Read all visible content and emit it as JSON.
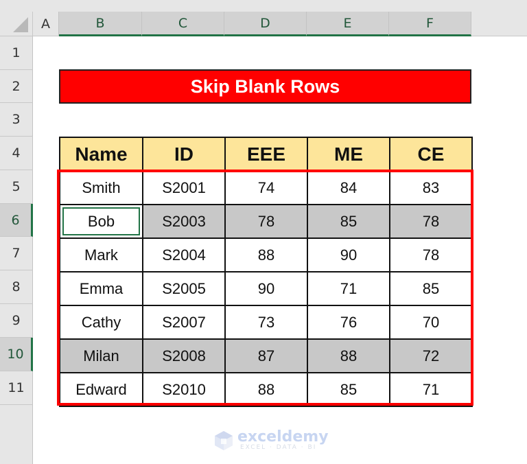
{
  "spreadsheet": {
    "columns": [
      "A",
      "B",
      "C",
      "D",
      "E",
      "F"
    ],
    "rows": [
      "1",
      "2",
      "3",
      "4",
      "5",
      "6",
      "7",
      "8",
      "9",
      "10",
      "11"
    ],
    "selected_columns": [
      "B",
      "C",
      "D",
      "E",
      "F"
    ],
    "selected_rows": [
      "6",
      "10"
    ],
    "active_cell": "B6"
  },
  "title": "Skip Blank Rows",
  "table": {
    "headers": [
      "Name",
      "ID",
      "EEE",
      "ME",
      "CE"
    ],
    "rows": [
      {
        "cells": [
          "Smith",
          "S2001",
          "74",
          "84",
          "83"
        ],
        "highlighted": false
      },
      {
        "cells": [
          "Bob",
          "S2003",
          "78",
          "85",
          "78"
        ],
        "highlighted": true
      },
      {
        "cells": [
          "Mark",
          "S2004",
          "88",
          "90",
          "78"
        ],
        "highlighted": false
      },
      {
        "cells": [
          "Emma",
          "S2005",
          "90",
          "71",
          "85"
        ],
        "highlighted": false
      },
      {
        "cells": [
          "Cathy",
          "S2007",
          "73",
          "76",
          "70"
        ],
        "highlighted": false
      },
      {
        "cells": [
          "Milan",
          "S2008",
          "87",
          "88",
          "72"
        ],
        "highlighted": true
      },
      {
        "cells": [
          "Edward",
          "S2010",
          "88",
          "85",
          "71"
        ],
        "highlighted": false
      }
    ]
  },
  "colors": {
    "title_bg": "#ff0000",
    "header_bg": "#fde59a",
    "highlight_bg": "#c8c8c8",
    "selection_accent": "#217346",
    "outline_border": "#ff0000"
  },
  "watermark": {
    "name": "exceldemy",
    "tagline": "EXCEL · DATA · BI"
  }
}
